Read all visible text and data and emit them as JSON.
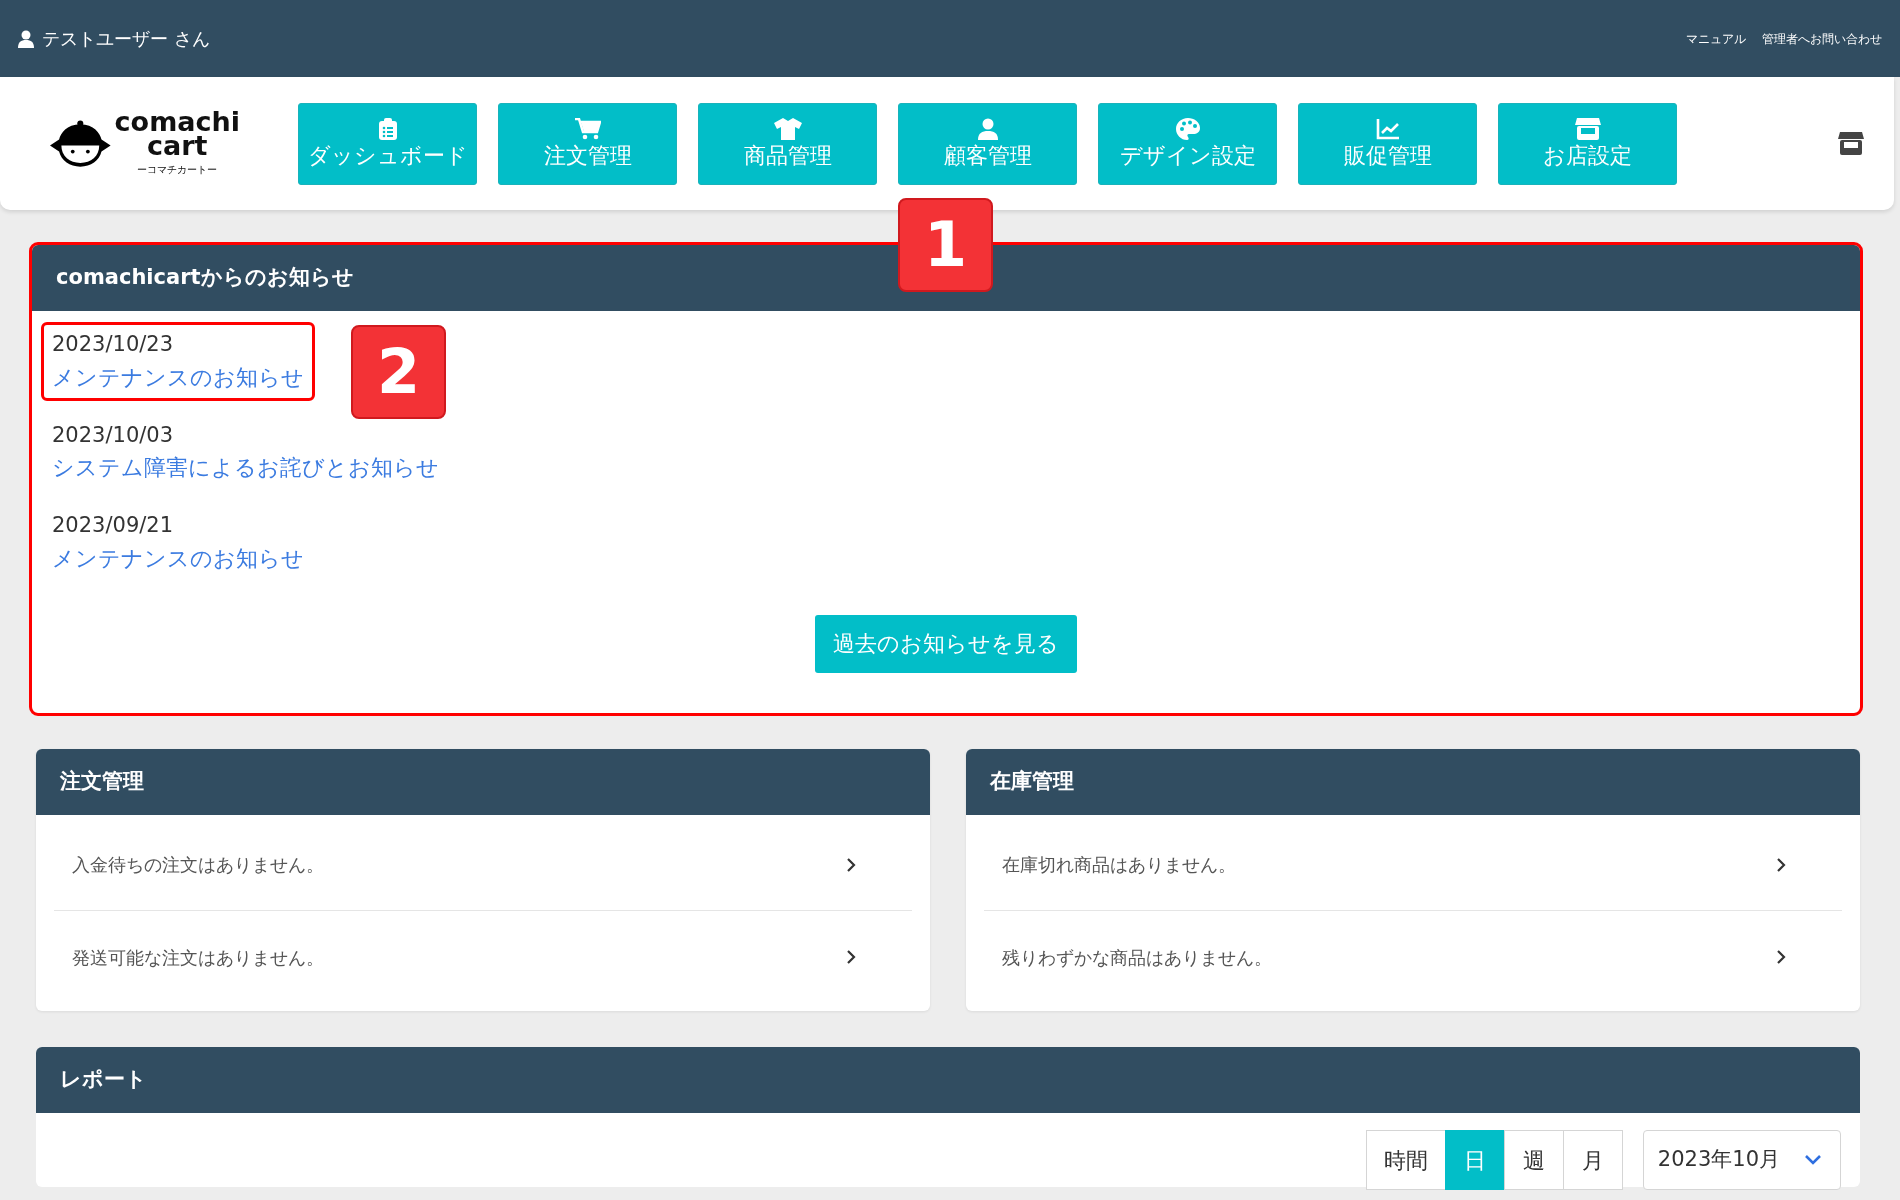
{
  "top_bar": {
    "user": "テストユーザー さん",
    "links": [
      "マニュアル",
      "管理者へお問い合わせ"
    ]
  },
  "logo": {
    "name_line1": "comachi",
    "name_line2": "cart",
    "reading": "ーコマチカートー"
  },
  "nav": [
    {
      "label": "ダッシュボード"
    },
    {
      "label": "注文管理"
    },
    {
      "label": "商品管理"
    },
    {
      "label": "顧客管理"
    },
    {
      "label": "デザイン設定"
    },
    {
      "label": "販促管理"
    },
    {
      "label": "お店設定"
    }
  ],
  "notices": {
    "title": "comachicartからのお知らせ",
    "highlighted": true,
    "callout": "1",
    "items": [
      {
        "date": "2023/10/23",
        "title": "メンテナンスのお知らせ",
        "highlighted": true,
        "callout": "2"
      },
      {
        "date": "2023/10/03",
        "title": "システム障害によるお詫びとお知らせ",
        "highlighted": false
      },
      {
        "date": "2023/09/21",
        "title": "メンテナンスのお知らせ",
        "highlighted": false
      }
    ],
    "more_button": "過去のお知らせを見る"
  },
  "panels": [
    {
      "title": "注文管理",
      "rows": [
        "入金待ちの注文はありません。",
        "発送可能な注文はありません。"
      ]
    },
    {
      "title": "在庫管理",
      "rows": [
        "在庫切れ商品はありません。",
        "残りわずかな商品はありません。"
      ]
    }
  ],
  "report": {
    "title": "レポート",
    "periods": [
      {
        "label": "時間",
        "selected": false
      },
      {
        "label": "日",
        "selected": true
      },
      {
        "label": "週",
        "selected": false
      },
      {
        "label": "月",
        "selected": false
      }
    ],
    "month": "2023年10月"
  }
}
